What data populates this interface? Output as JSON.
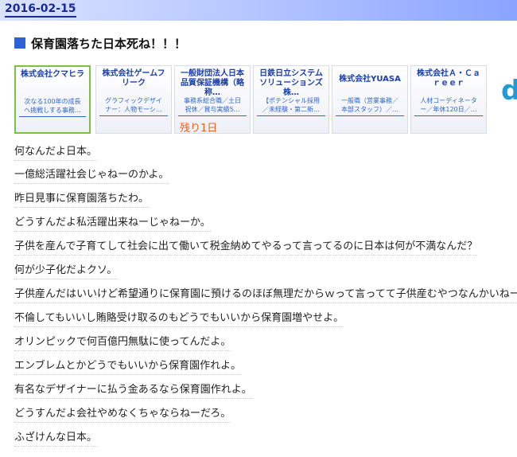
{
  "header": {
    "date": "2016-02-15"
  },
  "post": {
    "title": "保育園落ちた日本死ね！！！",
    "lines": [
      "何なんだよ日本。",
      "一億総活躍社会じゃねーのかよ。",
      "昨日見事に保育園落ちたわ。",
      "どうすんだよ私活躍出来ねーじゃねーか。",
      "子供を産んで子育てして社会に出て働いて税金納めてやるって言ってるのに日本は何が不満なんだ？",
      "何が少子化だよクソ。",
      "子供産んだはいいけど希望通りに保育園に預けるのほぼ無理だからｗって言ってて子供産むやつなんかいねーよ。",
      "不倫してもいいし賄賂受け取るのもどうでもいいから保育園増やせよ。",
      "オリンピックで何百億円無駄に使ってんだよ。",
      "エンブレムとかどうでもいいから保育園作れよ。",
      "有名なデザイナーに払う金あるなら保育園作れよ。",
      "どうすんだよ会社やめなくちゃならねーだろ。",
      "ふざけんな日本。"
    ]
  },
  "ads": {
    "items": [
      {
        "company": "株式会社クマヒラ",
        "desc": "次なる100年の成長へ挑戦しする事務…",
        "badge": ""
      },
      {
        "company": "株式会社ゲームフリーク",
        "desc": "グラフィックデザイナー：人物モーシ…",
        "badge": ""
      },
      {
        "company": "一般財団法人日本品質保証機構（略称…",
        "desc": "事務系総合職／土日祝休／賞与実績5…",
        "badge": "残り1日"
      },
      {
        "company": "日鉄日立システムソリューションズ株…",
        "desc": "【ポテンシャル採用／未経験・第二新…",
        "badge": ""
      },
      {
        "company": "株式会社YUASA",
        "desc": "一般職（営業事務／本部スタッフ）／…",
        "badge": ""
      },
      {
        "company": "株式会社Ａ・Ｃａｒｅｅｒ",
        "desc": "人材コーディネーター／年休120日／…",
        "badge": ""
      }
    ],
    "logo_letter": "d"
  }
}
